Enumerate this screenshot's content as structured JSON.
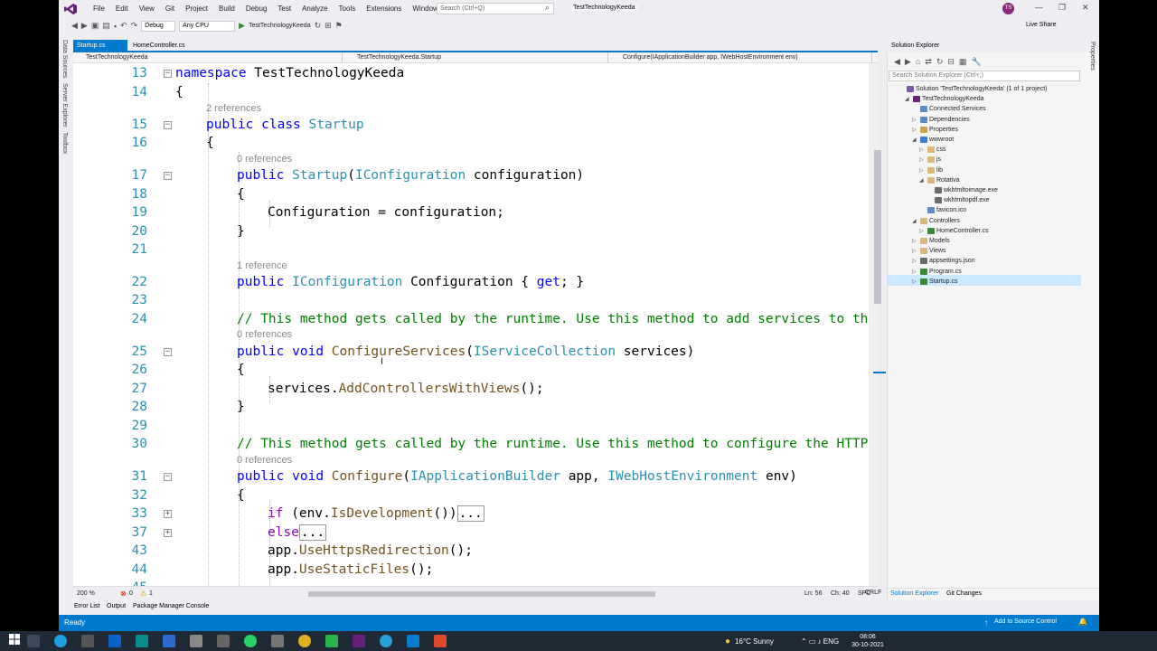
{
  "menu": [
    "File",
    "Edit",
    "View",
    "Git",
    "Project",
    "Build",
    "Debug",
    "Test",
    "Analyze",
    "Tools",
    "Extensions",
    "Window",
    "Help"
  ],
  "search_placeholder": "Search (Ctrl+Q)",
  "solution_title": "TestTechnologyKeeda",
  "avatar_initials": "TS",
  "toolbar": {
    "config": "Debug",
    "platform": "Any CPU",
    "run_target": "TestTechnologyKeeda",
    "live_share": "Live Share"
  },
  "left_tabs": [
    "Data Sources",
    "Server Explorer",
    "Toolbox"
  ],
  "doc_tabs": [
    "Startup.cs",
    "HomeController.cs"
  ],
  "nav": {
    "project": "TestTechnologyKeeda",
    "class": "TestTechnologyKeeda.Startup",
    "member": "Configure(IApplicationBuilder app, IWebHostEnvironment env)"
  },
  "code_lines": [
    {
      "n": "13",
      "t": "namespace TestTechnologyKeeda"
    },
    {
      "n": "14",
      "t": "{"
    },
    {
      "n": "15",
      "t": "public class Startup"
    },
    {
      "n": "16",
      "t": "{"
    },
    {
      "n": "17",
      "t": "public Startup(IConfiguration configuration)"
    },
    {
      "n": "18",
      "t": "{"
    },
    {
      "n": "19",
      "t": "Configuration = configuration;"
    },
    {
      "n": "20",
      "t": "}"
    },
    {
      "n": "21",
      "t": ""
    },
    {
      "n": "22",
      "t": "public IConfiguration Configuration { get; }"
    },
    {
      "n": "23",
      "t": ""
    },
    {
      "n": "24",
      "t": "// This method gets called by the runtime. Use this method to add services to the"
    },
    {
      "n": "25",
      "t": "public void ConfigureServices(IServiceCollection services)"
    },
    {
      "n": "26",
      "t": "{"
    },
    {
      "n": "27",
      "t": "services.AddControllersWithViews();"
    },
    {
      "n": "28",
      "t": "}"
    },
    {
      "n": "29",
      "t": ""
    },
    {
      "n": "30",
      "t": "// This method gets called by the runtime. Use this method to configure the HTTP r"
    },
    {
      "n": "31",
      "t": "public void Configure(IApplicationBuilder app, IWebHostEnvironment env)"
    },
    {
      "n": "32",
      "t": "{"
    },
    {
      "n": "33",
      "t": "if (env.IsDevelopment())..."
    },
    {
      "n": "37",
      "t": "else..."
    },
    {
      "n": "43",
      "t": "app.UseHttpsRedirection();"
    },
    {
      "n": "44",
      "t": "app.UseStaticFiles();"
    },
    {
      "n": "45",
      "t": ""
    }
  ],
  "codelens": [
    "2 references",
    "0 references",
    "1 reference",
    "0 references",
    "0 references"
  ],
  "editor_status": {
    "zoom": "200 %",
    "errors": "0",
    "warnings": "1",
    "ln": "Ln: 56",
    "ch": "Ch: 40",
    "spc": "SPC",
    "crlf": "CRLF"
  },
  "solution_explorer": {
    "title": "Solution Explorer",
    "search_placeholder": "Search Solution Explorer (Ctrl+;)",
    "nodes": [
      {
        "label": "Solution 'TestTechnologyKeeda' (1 of 1 project)",
        "color": "#7a5aa6",
        "arrow": ""
      },
      {
        "label": "TestTechnologyKeeda",
        "color": "#68217a",
        "arrow": "◢"
      },
      {
        "label": "Connected Services",
        "color": "#5a8cc8",
        "arrow": ""
      },
      {
        "label": "Dependencies",
        "color": "#5a8cc8",
        "arrow": "▷"
      },
      {
        "label": "Properties",
        "color": "#c9a64a",
        "arrow": "▷"
      },
      {
        "label": "wwwroot",
        "color": "#3a7fd8",
        "arrow": "◢"
      },
      {
        "label": "css",
        "color": "#dcb67a",
        "arrow": "▷"
      },
      {
        "label": "js",
        "color": "#dcb67a",
        "arrow": "▷"
      },
      {
        "label": "lib",
        "color": "#dcb67a",
        "arrow": "▷"
      },
      {
        "label": "Rotativa",
        "color": "#dcb67a",
        "arrow": "◢"
      },
      {
        "label": "wkhtmltoimage.exe",
        "color": "#6a6a6a",
        "arrow": ""
      },
      {
        "label": "wkhtmltopdf.exe",
        "color": "#6a6a6a",
        "arrow": ""
      },
      {
        "label": "favicon.ico",
        "color": "#5a8cc8",
        "arrow": ""
      },
      {
        "label": "Controllers",
        "color": "#dcb67a",
        "arrow": "◢"
      },
      {
        "label": "HomeController.cs",
        "color": "#388a34",
        "arrow": "▷"
      },
      {
        "label": "Models",
        "color": "#dcb67a",
        "arrow": "▷"
      },
      {
        "label": "Views",
        "color": "#dcb67a",
        "arrow": "▷"
      },
      {
        "label": "appsettings.json",
        "color": "#6a6a6a",
        "arrow": "▷"
      },
      {
        "label": "Program.cs",
        "color": "#388a34",
        "arrow": "▷"
      },
      {
        "label": "Startup.cs",
        "color": "#388a34",
        "arrow": "▷"
      }
    ],
    "tabs": [
      "Solution Explorer",
      "Git Changes"
    ]
  },
  "right_edge_tab": "Properties",
  "bottom_tabs": [
    "Error List",
    "Output",
    "Package Manager Console"
  ],
  "status": {
    "ready": "Ready",
    "source_control": "Add to Source Control"
  },
  "taskbar": {
    "weather": "16°C  Sunny",
    "time": "08:06",
    "date": "30-10-2021"
  }
}
